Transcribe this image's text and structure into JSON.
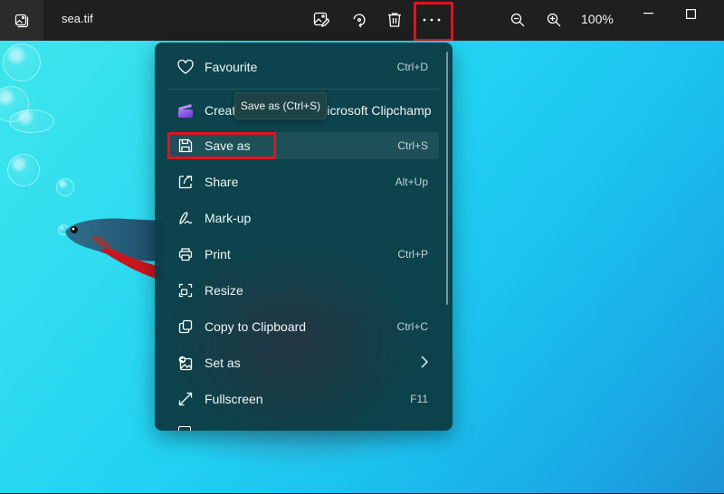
{
  "titlebar": {
    "file_name": "sea.tif",
    "zoom_level": "100%",
    "buttons": {
      "app_icon": "gallery-icon",
      "edit": "edit-image-icon",
      "rotate": "rotate-icon",
      "delete": "delete-icon",
      "more": "more-options-icon",
      "zoom_out": "zoom-out-icon",
      "zoom_in": "zoom-in-icon",
      "minimize": "minimize-icon",
      "maximize": "maximize-icon"
    }
  },
  "menu": {
    "items": [
      {
        "label": "Favourite",
        "shortcut": "Ctrl+D",
        "icon": "heart-icon"
      },
      {
        "label": "Create a video with Microsoft Clipchamp",
        "shortcut": "",
        "icon": "clipchamp-icon"
      },
      {
        "label": "Save as",
        "shortcut": "Ctrl+S",
        "icon": "save-icon"
      },
      {
        "label": "Share",
        "shortcut": "Alt+Up",
        "icon": "share-icon"
      },
      {
        "label": "Mark-up",
        "shortcut": "",
        "icon": "markup-icon"
      },
      {
        "label": "Print",
        "shortcut": "Ctrl+P",
        "icon": "print-icon"
      },
      {
        "label": "Resize",
        "shortcut": "",
        "icon": "resize-icon"
      },
      {
        "label": "Copy to Clipboard",
        "shortcut": "Ctrl+C",
        "icon": "copy-icon"
      },
      {
        "label": "Set as",
        "shortcut": "",
        "icon": "set-as-icon",
        "submenu": true
      },
      {
        "label": "Fullscreen",
        "shortcut": "F11",
        "icon": "fullscreen-icon"
      }
    ]
  },
  "tooltip": {
    "text": "Save as (Ctrl+S)"
  },
  "colors": {
    "highlight": "#e0141e",
    "menu_bg": "#0b3e46",
    "titlebar_bg": "#1f1f1f"
  }
}
